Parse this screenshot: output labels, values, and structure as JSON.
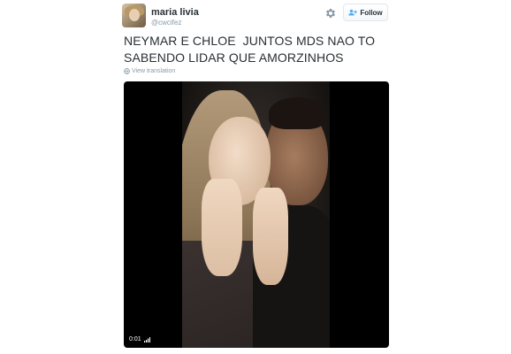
{
  "user": {
    "display_name": "maria livia",
    "screen_name": "@cwcifez",
    "avatar_icon": "profile-photo"
  },
  "actions": {
    "settings_icon": "gear-icon",
    "follow_icon": "add-user-icon",
    "follow_label": "Follow"
  },
  "tweet": {
    "line1": "NEYMAR E CHLOE  JUNTOS MDS NAO TO",
    "line2": "SABENDO LIDAR QUE AMORZINHOS"
  },
  "translate": {
    "icon": "globe-icon",
    "label": "View translation"
  },
  "video": {
    "time": "0:01",
    "volume_icon": "volume-bars-icon"
  },
  "colors": {
    "text": "#292f33",
    "muted": "#8899a6",
    "accent": "#55acee",
    "video_bg": "#000000"
  }
}
